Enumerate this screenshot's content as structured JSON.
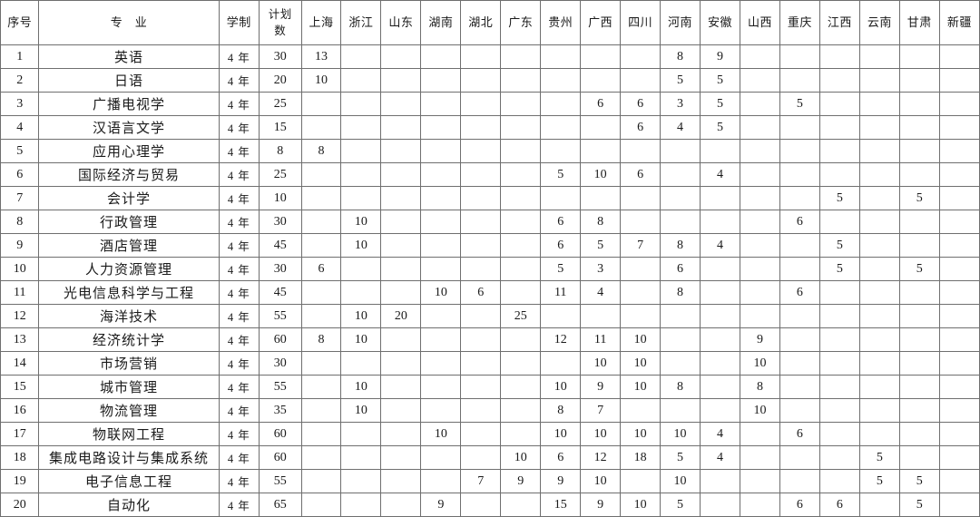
{
  "table": {
    "headers": {
      "index": "序号",
      "major": "专　业",
      "years": "学制",
      "total_line1": "计划",
      "total_line2": "数",
      "provinces": [
        "上海",
        "浙江",
        "山东",
        "湖南",
        "湖北",
        "广东",
        "贵州",
        "广西",
        "四川",
        "河南",
        "安徽",
        "山西",
        "重庆",
        "江西",
        "云南",
        "甘肃",
        "新疆"
      ]
    },
    "rows": [
      {
        "index": "1",
        "major": "英语",
        "years": "4 年",
        "total": "30",
        "bold": true,
        "values": [
          "13",
          "",
          "",
          "",
          "",
          "",
          "",
          "",
          "",
          "8",
          "9",
          "",
          "",
          "",
          "",
          "",
          ""
        ]
      },
      {
        "index": "2",
        "major": "日语",
        "years": "4 年",
        "total": "20",
        "bold": true,
        "values": [
          "10",
          "",
          "",
          "",
          "",
          "",
          "",
          "",
          "",
          "5",
          "5",
          "",
          "",
          "",
          "",
          "",
          ""
        ]
      },
      {
        "index": "3",
        "major": "广播电视学",
        "years": "4 年",
        "total": "25",
        "bold": true,
        "values": [
          "",
          "",
          "",
          "",
          "",
          "",
          "",
          "6",
          "6",
          "3",
          "5",
          "",
          "5",
          "",
          "",
          "",
          ""
        ]
      },
      {
        "index": "4",
        "major": "汉语言文学",
        "years": "4 年",
        "total": "15",
        "bold": true,
        "values": [
          "",
          "",
          "",
          "",
          "",
          "",
          "",
          "",
          "6",
          "4",
          "5",
          "",
          "",
          "",
          "",
          "",
          ""
        ]
      },
      {
        "index": "5",
        "major": "应用心理学",
        "years": "4 年",
        "total": "8",
        "bold": true,
        "values": [
          "8",
          "",
          "",
          "",
          "",
          "",
          "",
          "",
          "",
          "",
          "",
          "",
          "",
          "",
          "",
          "",
          ""
        ]
      },
      {
        "index": "6",
        "major": "国际经济与贸易",
        "years": "4 年",
        "total": "25",
        "bold": true,
        "values": [
          "",
          "",
          "",
          "",
          "",
          "",
          "5",
          "10",
          "6",
          "",
          "4",
          "",
          "",
          "",
          "",
          "",
          ""
        ]
      },
      {
        "index": "7",
        "major": "会计学",
        "years": "4 年",
        "total": "10",
        "bold": true,
        "values": [
          "",
          "",
          "",
          "",
          "",
          "",
          "",
          "",
          "",
          "",
          "",
          "",
          "",
          "5",
          "",
          "5",
          ""
        ]
      },
      {
        "index": "8",
        "major": "行政管理",
        "years": "4 年",
        "total": "30",
        "bold": true,
        "values": [
          "",
          "10",
          "",
          "",
          "",
          "",
          "6",
          "8",
          "",
          "",
          "",
          "",
          "6",
          "",
          "",
          "",
          ""
        ]
      },
      {
        "index": "9",
        "major": "酒店管理",
        "years": "4 年",
        "total": "45",
        "bold": true,
        "values": [
          "",
          "10",
          "",
          "",
          "",
          "",
          "6",
          "5",
          "7",
          "8",
          "4",
          "",
          "",
          "5",
          "",
          "",
          ""
        ]
      },
      {
        "index": "10",
        "major": "人力资源管理",
        "years": "4 年",
        "total": "30",
        "bold": true,
        "values": [
          "6",
          "",
          "",
          "",
          "",
          "",
          "5",
          "3",
          "",
          "6",
          "",
          "",
          "",
          "5",
          "",
          "5",
          ""
        ]
      },
      {
        "index": "11",
        "major": "光电信息科学与工程",
        "years": "4 年",
        "total": "45",
        "bold": false,
        "values": [
          "",
          "",
          "",
          "10",
          "6",
          "",
          "11",
          "4",
          "",
          "8",
          "",
          "",
          "6",
          "",
          "",
          "",
          ""
        ]
      },
      {
        "index": "12",
        "major": "海洋技术",
        "years": "4 年",
        "total": "55",
        "bold": false,
        "values": [
          "",
          "10",
          "20",
          "",
          "",
          "25",
          "",
          "",
          "",
          "",
          "",
          "",
          "",
          "",
          "",
          "",
          ""
        ]
      },
      {
        "index": "13",
        "major": "经济统计学",
        "years": "4 年",
        "total": "60",
        "bold": false,
        "values": [
          "8",
          "10",
          "",
          "",
          "",
          "",
          "12",
          "11",
          "10",
          "",
          "",
          "9",
          "",
          "",
          "",
          "",
          ""
        ]
      },
      {
        "index": "14",
        "major": "市场营销",
        "years": "4 年",
        "total": "30",
        "bold": false,
        "values": [
          "",
          "",
          "",
          "",
          "",
          "",
          "",
          "10",
          "10",
          "",
          "",
          "10",
          "",
          "",
          "",
          "",
          ""
        ]
      },
      {
        "index": "15",
        "major": "城市管理",
        "years": "4 年",
        "total": "55",
        "bold": false,
        "values": [
          "",
          "10",
          "",
          "",
          "",
          "",
          "10",
          "9",
          "10",
          "8",
          "",
          "8",
          "",
          "",
          "",
          "",
          ""
        ]
      },
      {
        "index": "16",
        "major": "物流管理",
        "years": "4 年",
        "total": "35",
        "bold": false,
        "values": [
          "",
          "10",
          "",
          "",
          "",
          "",
          "8",
          "7",
          "",
          "",
          "",
          "10",
          "",
          "",
          "",
          "",
          ""
        ]
      },
      {
        "index": "17",
        "major": "物联网工程",
        "years": "4 年",
        "total": "60",
        "bold": false,
        "values": [
          "",
          "",
          "",
          "10",
          "",
          "",
          "10",
          "10",
          "10",
          "10",
          "4",
          "",
          "6",
          "",
          "",
          "",
          ""
        ]
      },
      {
        "index": "18",
        "major": "集成电路设计与集成系统",
        "years": "4 年",
        "total": "60",
        "bold": false,
        "values": [
          "",
          "",
          "",
          "",
          "",
          "10",
          "6",
          "12",
          "18",
          "5",
          "4",
          "",
          "",
          "",
          "5",
          "",
          ""
        ]
      },
      {
        "index": "19",
        "major": "电子信息工程",
        "years": "4 年",
        "total": "55",
        "bold": false,
        "values": [
          "",
          "",
          "",
          "",
          "7",
          "9",
          "9",
          "10",
          "",
          "10",
          "",
          "",
          "",
          "",
          "5",
          "5",
          ""
        ]
      },
      {
        "index": "20",
        "major": "自动化",
        "years": "4 年",
        "total": "65",
        "bold": false,
        "values": [
          "",
          "",
          "",
          "9",
          "",
          "",
          "15",
          "9",
          "10",
          "5",
          "",
          "",
          "6",
          "6",
          "",
          "5",
          ""
        ]
      }
    ]
  }
}
